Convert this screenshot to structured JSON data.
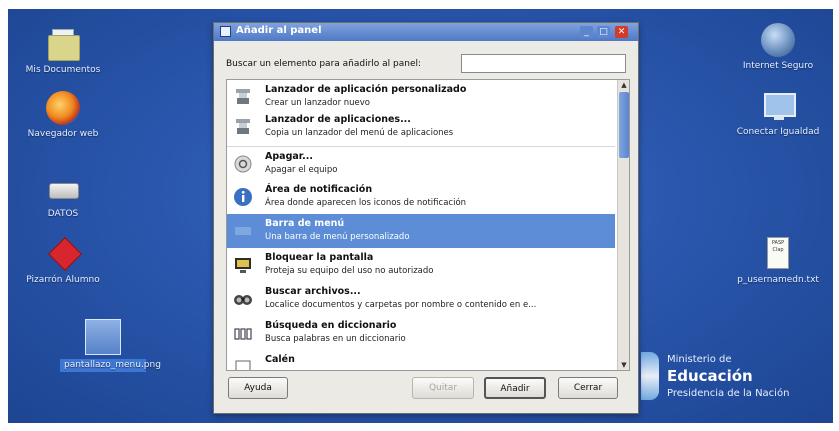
{
  "desktop": {
    "icons_left": [
      {
        "label": "Mis Documentos",
        "icon": "folder-icon"
      },
      {
        "label": "Navegador web",
        "icon": "firefox-icon"
      },
      {
        "label": "DATOS",
        "icon": "drive-icon"
      },
      {
        "label": "Pizarrón Alumno",
        "icon": "pizarron-icon"
      },
      {
        "label": "pantallazo_menu.png",
        "icon": "image-file-icon"
      }
    ],
    "icons_right": [
      {
        "label": "Internet Seguro",
        "icon": "globe-icon"
      },
      {
        "label": "Conectar Igualdad",
        "icon": "monitor-icon"
      },
      {
        "label": "p_usernamedn.txt",
        "icon": "text-file-icon"
      }
    ],
    "doc_preview": {
      "line1": "PASP",
      "line2": "Clap"
    }
  },
  "dialog": {
    "title": "Añadir al panel",
    "title_buttons": {
      "minimize": "_",
      "maximize": "□",
      "close": "✕"
    },
    "search": {
      "label": "Buscar un elemento para añadirlo al panel:",
      "value": "",
      "placeholder": ""
    },
    "items": [
      {
        "title": "Lanzador de aplicación personalizado",
        "desc": "Crear un lanzador nuevo",
        "icon": "launcher-icon",
        "selected": false
      },
      {
        "title": "Lanzador de aplicaciones...",
        "desc": "Copia un lanzador del menú de aplicaciones",
        "icon": "launcher-icon",
        "selected": false
      },
      {
        "title": "Apagar...",
        "desc": "Apagar el equipo",
        "icon": "power-icon",
        "selected": false
      },
      {
        "title": "Área de notificación",
        "desc": "Área donde aparecen los iconos de notificación",
        "icon": "info-icon",
        "selected": false
      },
      {
        "title": "Barra de menú",
        "desc": "Una barra de menú personalizado",
        "icon": "menubar-icon",
        "selected": true
      },
      {
        "title": "Bloquear la pantalla",
        "desc": "Proteja su equipo del uso no autorizado",
        "icon": "lock-screen-icon",
        "selected": false
      },
      {
        "title": "Buscar archivos...",
        "desc": "Localice documentos y carpetas por nombre o contenido en e...",
        "icon": "search-icon",
        "selected": false
      },
      {
        "title": "Búsqueda en diccionario",
        "desc": "Busca palabras en un diccionario",
        "icon": "dictionary-icon",
        "selected": false
      },
      {
        "title": "Calén",
        "desc": "",
        "icon": "calendar-icon",
        "selected": false
      }
    ],
    "buttons": {
      "help": "Ayuda",
      "remove": "Quitar",
      "add": "Añadir",
      "close": "Cerrar"
    }
  },
  "ministry": {
    "line1": "Ministerio de",
    "line2": "Educación",
    "line3": "Presidencia de la Nación"
  },
  "colors": {
    "desktop": "#2a57ad",
    "selection": "#5c8dd6",
    "titlebar": "#5a82cc",
    "close_button": "#d23b2a"
  }
}
